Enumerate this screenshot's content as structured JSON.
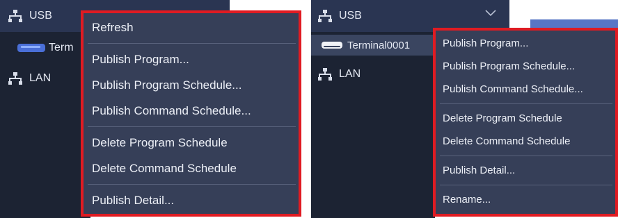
{
  "left_panel": {
    "tree": {
      "usb_label": "USB",
      "terminal_label": "Term",
      "lan_label": "LAN"
    },
    "context_menu": {
      "groups": [
        [
          "Refresh"
        ],
        [
          "Publish Program...",
          "Publish Program Schedule...",
          "Publish Command Schedule..."
        ],
        [
          "Delete Program Schedule",
          "Delete Command Schedule"
        ],
        [
          "Publish Detail..."
        ]
      ]
    }
  },
  "right_panel": {
    "tree": {
      "usb_label": "USB",
      "terminal_label": "Terminal0001",
      "lan_label": "LAN"
    },
    "context_menu": {
      "groups": [
        [
          "Publish Program...",
          "Publish Program Schedule...",
          "Publish Command Schedule..."
        ],
        [
          "Delete Program Schedule",
          "Delete Command Schedule"
        ],
        [
          "Publish Detail..."
        ],
        [
          "Rename..."
        ]
      ]
    }
  },
  "colors": {
    "sidebar_bg": "#1c2333",
    "menu_bg": "#363f58",
    "highlight_border": "#e01b22",
    "device_icon": "#4a6fd8",
    "accent_block": "#5876c6"
  }
}
